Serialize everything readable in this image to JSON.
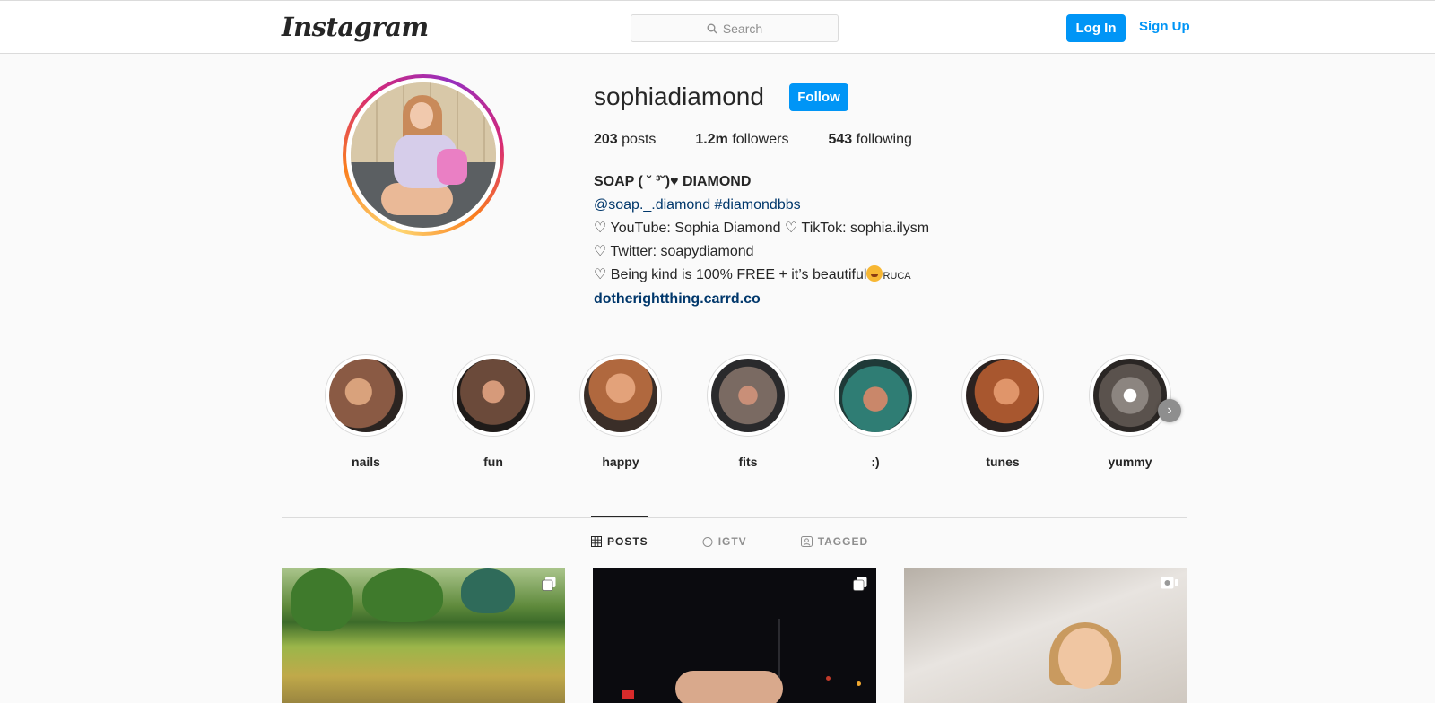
{
  "nav": {
    "logo": "Instagram",
    "search_placeholder": "Search",
    "login_label": "Log In",
    "signup_label": "Sign Up"
  },
  "profile": {
    "username": "sophiadiamond",
    "follow_label": "Follow",
    "stats": {
      "posts_count": "203",
      "posts_label": "posts",
      "followers_count": "1.2m",
      "followers_label": "followers",
      "following_count": "543",
      "following_label": "following"
    },
    "bio": {
      "name": "SOAP ( ˘ ³˘)♥ DIAMOND",
      "tags": "@soap._.diamond #diamondbbs",
      "line1": "♡ YouTube: Sophia Diamond ♡ TikTok: sophia.ilysm",
      "line2": "♡ Twitter: soapydiamond",
      "line3_text": "♡ Being kind is 100% FREE + it’s beautiful",
      "line3_suffix": "RUCA",
      "website": "dotherightthing.carrd.co"
    }
  },
  "highlights": [
    {
      "label": "nails",
      "color": "#8a5a44"
    },
    {
      "label": "fun",
      "color": "#6b4a3a"
    },
    {
      "label": "happy",
      "color": "#b0683e"
    },
    {
      "label": "fits",
      "color": "#7a6a62"
    },
    {
      "label": ":)",
      "color": "#2f7d74"
    },
    {
      "label": "tunes",
      "color": "#a8572f"
    },
    {
      "label": "yummy",
      "color": "#8c8580"
    }
  ],
  "tabs": {
    "posts": "POSTS",
    "igtv": "IGTV",
    "tagged": "TAGGED"
  },
  "colors": {
    "accent": "#0095f6",
    "link": "#00376b"
  },
  "posts": [
    {
      "badge": "carousel-icon"
    },
    {
      "badge": "carousel-icon"
    },
    {
      "badge": "video-icon"
    }
  ]
}
